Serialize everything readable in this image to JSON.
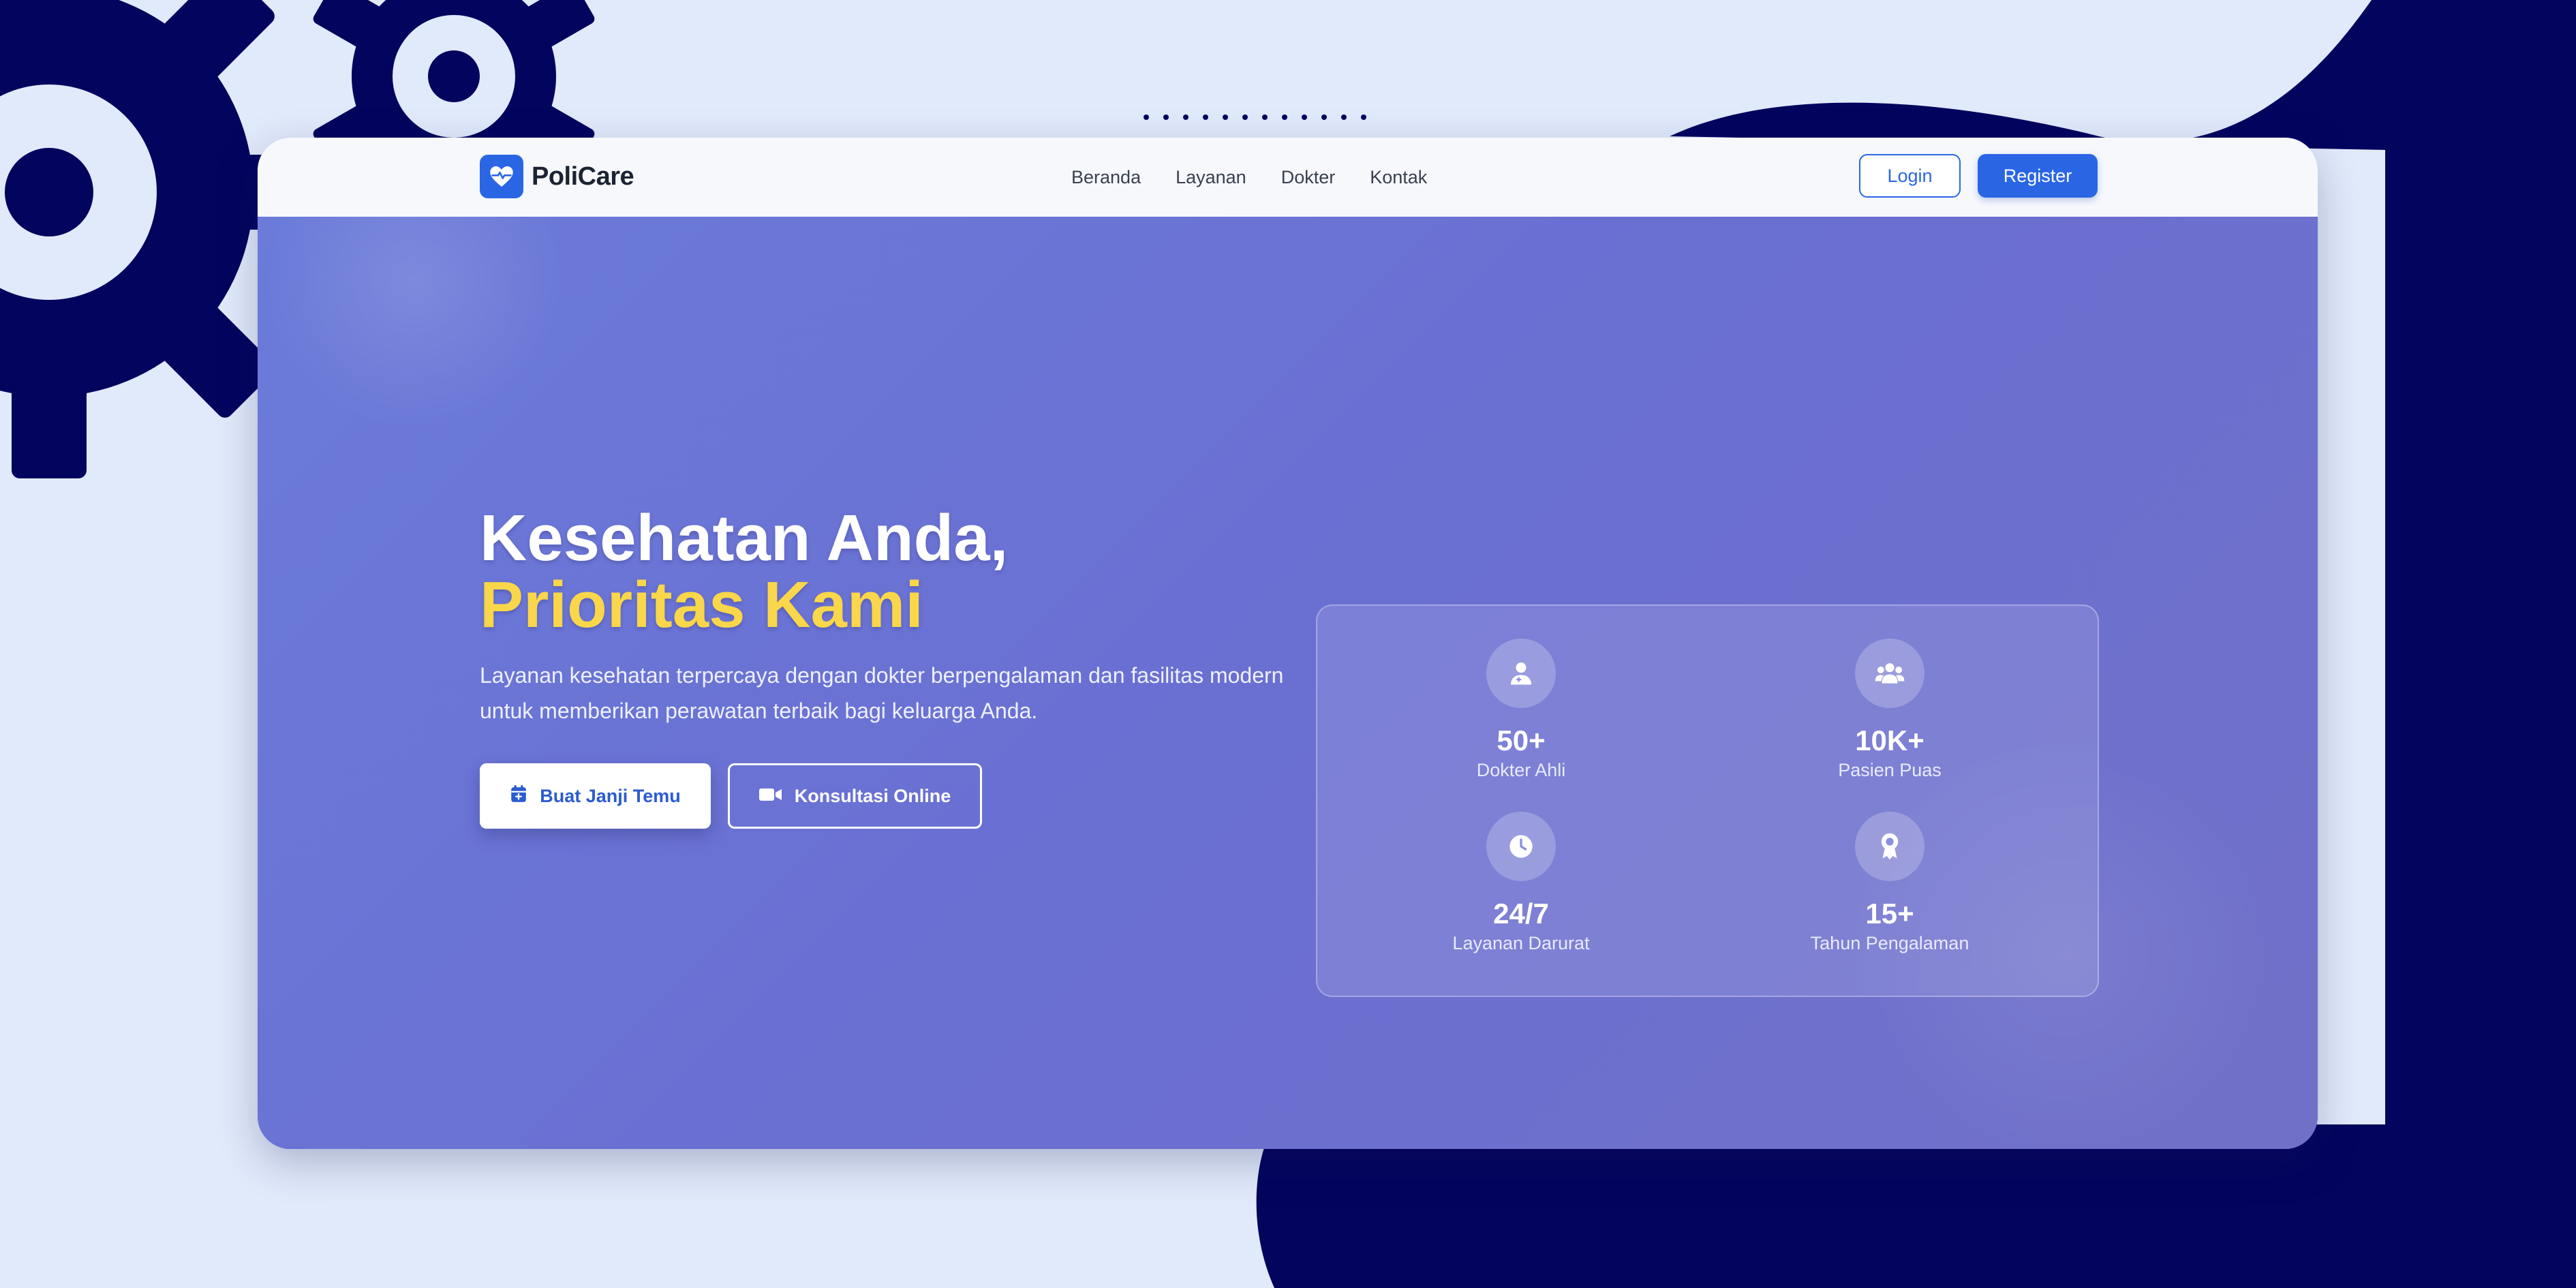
{
  "brand": {
    "name": "PoliCare",
    "logo_icon": "heart-pulse-icon",
    "color": "#2a66e4"
  },
  "nav": {
    "links": [
      "Beranda",
      "Layanan",
      "Dokter",
      "Kontak"
    ],
    "login_label": "Login",
    "register_label": "Register"
  },
  "hero": {
    "title_line1": "Kesehatan Anda,",
    "title_line2": "Prioritas Kami",
    "title_accent_color": "#f9d64a",
    "description": "Layanan kesehatan terpercaya dengan dokter berpengalaman dan fasilitas modern untuk memberikan perawatan terbaik bagi keluarga Anda.",
    "primary_button": {
      "label": "Buat Janji Temu",
      "icon": "calendar-icon"
    },
    "secondary_button": {
      "label": "Konsultasi Online",
      "icon": "video-camera-icon"
    }
  },
  "stats": [
    {
      "value": "50+",
      "label": "Dokter Ahli",
      "icon": "doctor-icon"
    },
    {
      "value": "10K+",
      "label": "Pasien Puas",
      "icon": "users-icon"
    },
    {
      "value": "24/7",
      "label": "Layanan Darurat",
      "icon": "clock-icon"
    },
    {
      "value": "15+",
      "label": "Tahun Pengalaman",
      "icon": "award-icon"
    }
  ],
  "colors": {
    "page_background": "#e1eafb",
    "decor_navy": "#03045e",
    "hero_gradient": "#6b7bd9"
  }
}
